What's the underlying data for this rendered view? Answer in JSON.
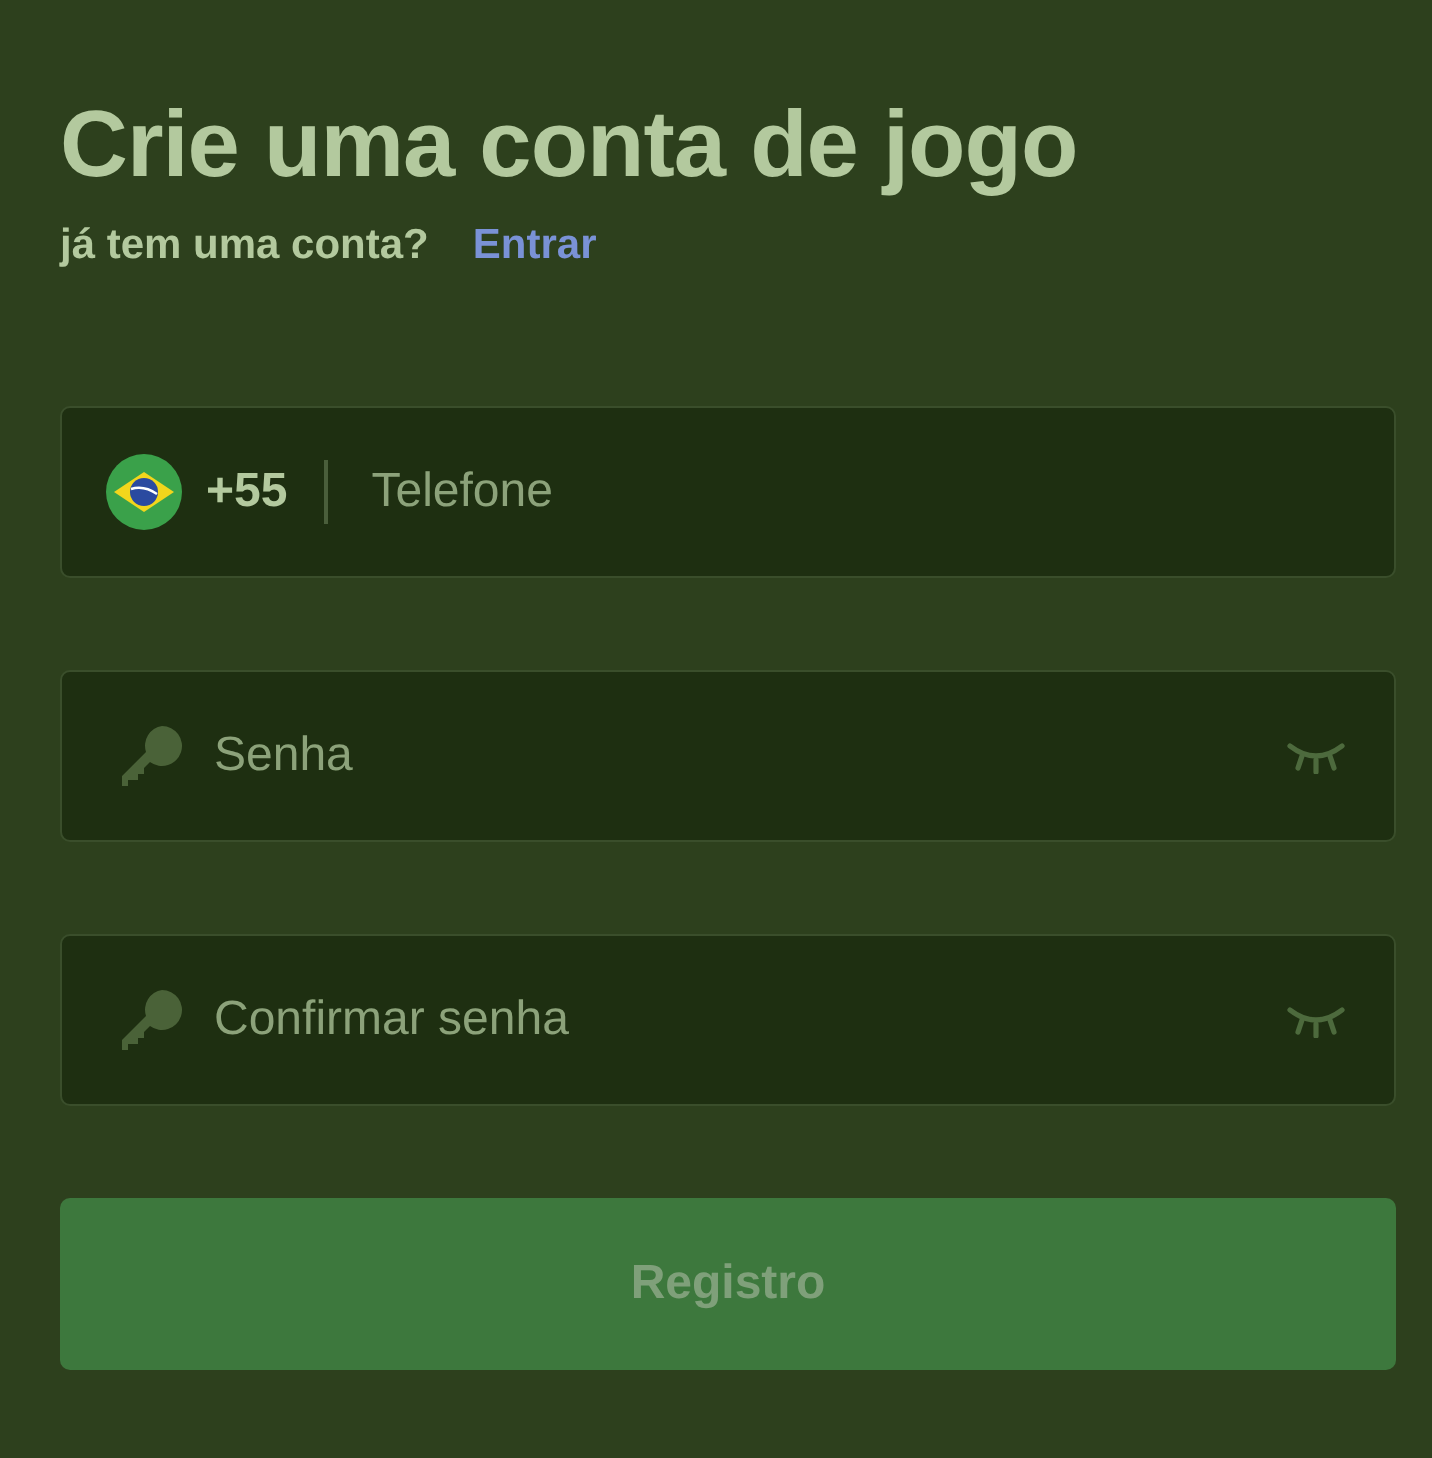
{
  "title": "Crie uma conta de jogo",
  "login_prompt": {
    "text": "já tem uma conta?",
    "link": "Entrar"
  },
  "fields": [
    {
      "kind": "phone",
      "country_code": "+55",
      "placeholder": "Telefone"
    },
    {
      "kind": "password",
      "placeholder": "Senha"
    },
    {
      "kind": "password",
      "placeholder": "Confirmar senha"
    }
  ],
  "submit_button": "Registro"
}
